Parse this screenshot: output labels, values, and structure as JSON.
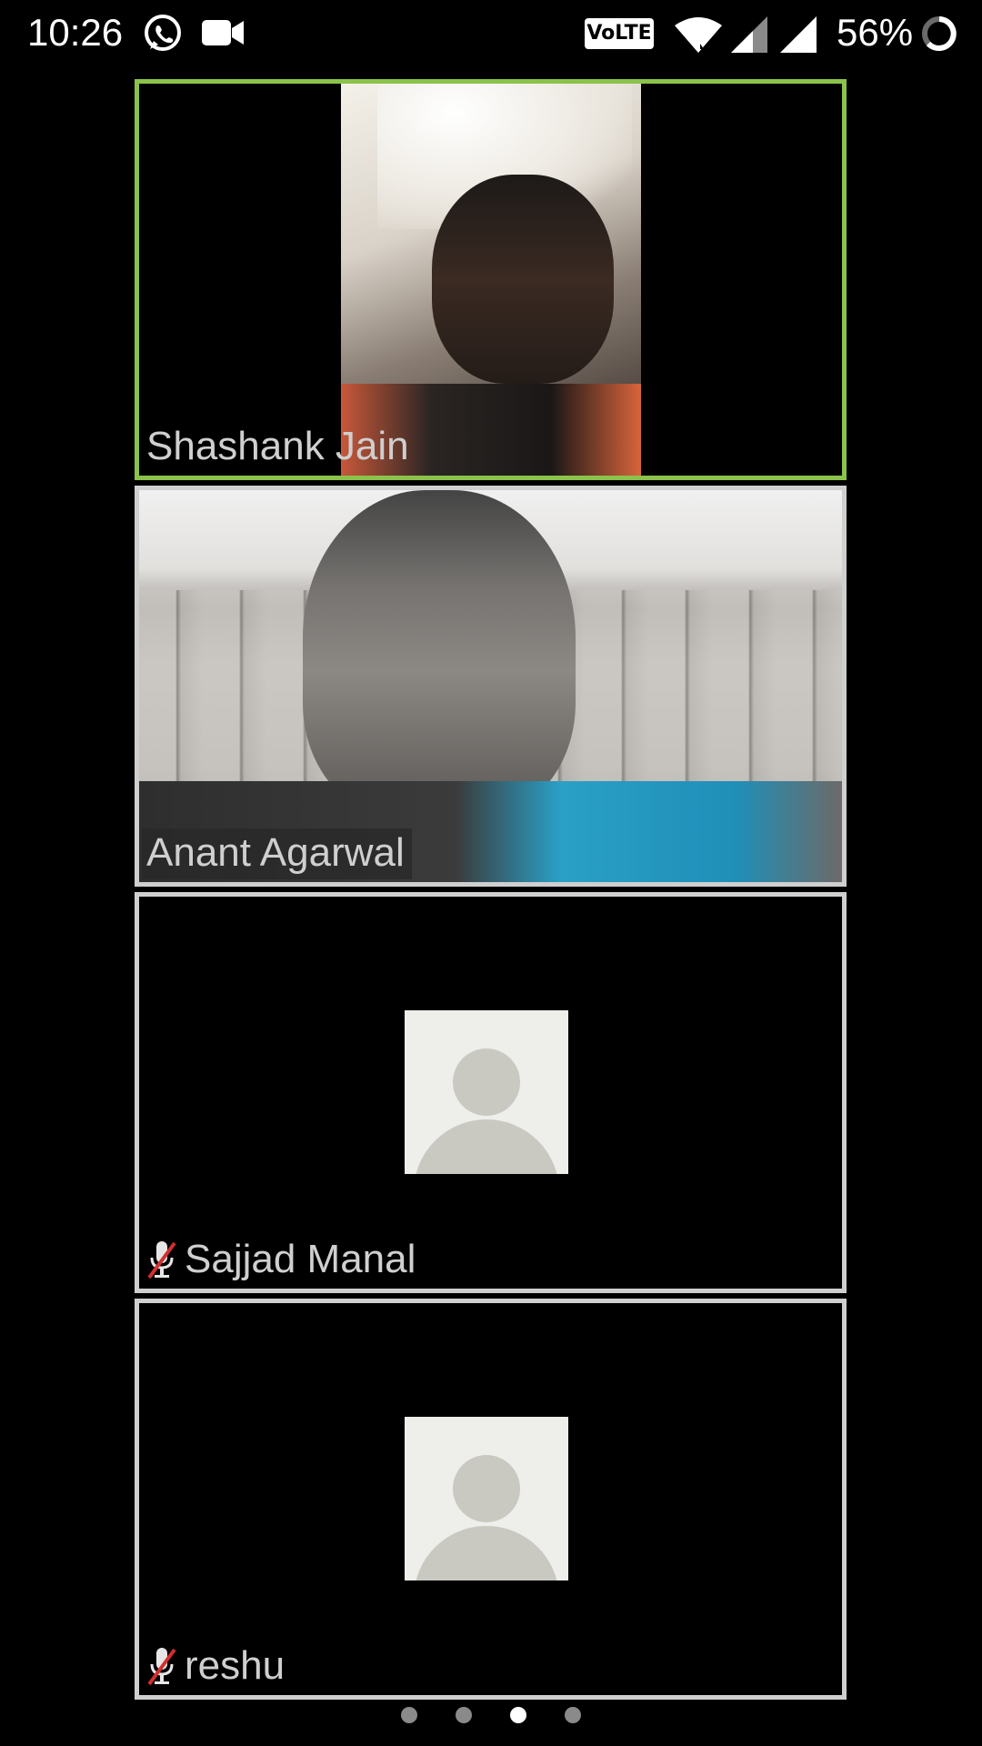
{
  "status_bar": {
    "time": "10:26",
    "left_icons": [
      "whatsapp-icon",
      "video-camera-icon"
    ],
    "network_badge": "VoLTE",
    "right_icons": [
      "wifi-icon",
      "signal-icon-1",
      "signal-icon-2",
      "battery-icon"
    ],
    "battery_percent": "56%"
  },
  "participants": [
    {
      "name": "Shashank Jain",
      "video": "on",
      "active_speaker": true,
      "muted": false
    },
    {
      "name": "Anant Agarwal",
      "video": "on",
      "active_speaker": false,
      "muted": false
    },
    {
      "name": "Sajjad Manal",
      "video": "off",
      "active_speaker": false,
      "muted": true
    },
    {
      "name": "reshu",
      "video": "off",
      "active_speaker": false,
      "muted": true
    }
  ],
  "pager": {
    "pages": 4,
    "current_page": 3
  },
  "colors": {
    "active_speaker_border": "#8bc34a",
    "tile_border": "#cfcfcf",
    "background": "#000000",
    "label_text": "#cfcfcf"
  }
}
